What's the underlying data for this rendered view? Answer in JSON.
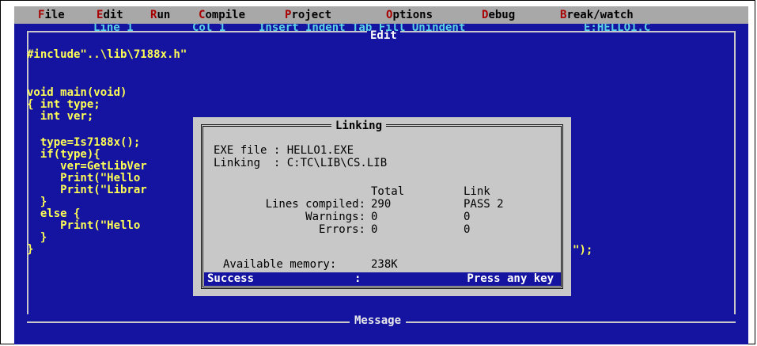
{
  "menubar": {
    "items": [
      {
        "hotkey": "F",
        "rest": "ile"
      },
      {
        "hotkey": "E",
        "rest": "dit"
      },
      {
        "hotkey": "R",
        "rest": "un"
      },
      {
        "hotkey": "C",
        "rest": "ompile"
      },
      {
        "hotkey": "P",
        "rest": "roject"
      },
      {
        "hotkey": "O",
        "rest": "ptions"
      },
      {
        "hotkey": "D",
        "rest": "ebug"
      },
      {
        "hotkey": "B",
        "rest": "reak/watch"
      }
    ]
  },
  "editor": {
    "title": "Edit",
    "status": {
      "line": "Line 1",
      "col": "Col 1",
      "modes": "Insert Indent Tab Fill Unindent",
      "file": "E:HELLO1.C"
    },
    "code_lines": [
      "#include\"..\\lib\\7188x.h\"",
      "",
      "void main(void)",
      "{ int type;",
      "  int ver;",
      "",
      "  type=Is7188x();",
      "  if(type){",
      "     ver=GetLibVer",
      "     Print(\"Hello",
      "     Print(\"Librar",
      "  }",
      "  else {",
      "     Print(\"Hello",
      "  }",
      "}"
    ],
    "right_fragment": "\");"
  },
  "dialog": {
    "title": "Linking",
    "exe_file": "EXE file : HELLO1.EXE",
    "linking": "Linking  : C:TC\\LIB\\CS.LIB",
    "col_total": "Total",
    "col_link": "Link",
    "rows": [
      {
        "label": "Lines compiled:",
        "total": "290",
        "link": "PASS 2"
      },
      {
        "label": "Warnings:",
        "total": "0",
        "link": "0"
      },
      {
        "label": "Errors:",
        "total": "0",
        "link": "0"
      }
    ],
    "memory_label": "Available memory:",
    "memory_value": "238K",
    "success_label": "Success",
    "success_colon": ":",
    "press_key": "Press any key"
  },
  "message": {
    "title": "Message"
  }
}
